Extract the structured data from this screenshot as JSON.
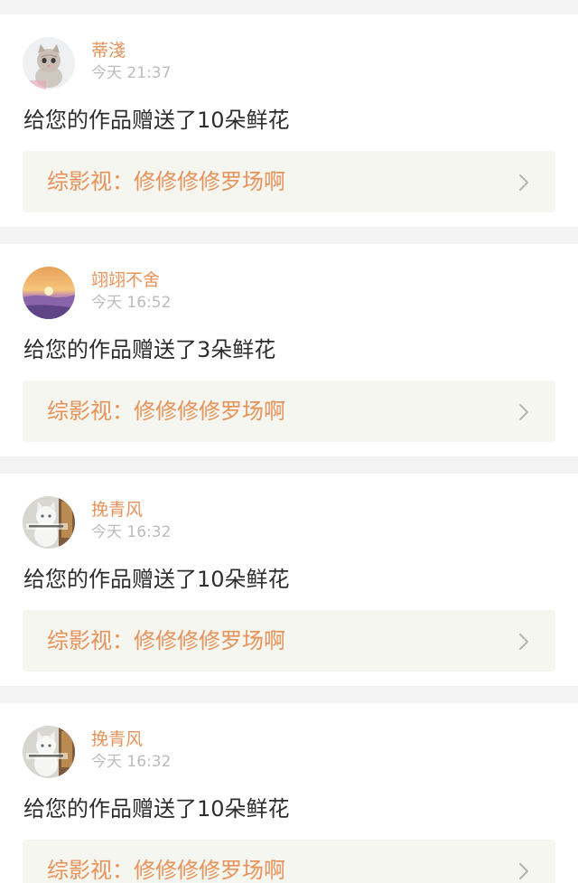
{
  "notifications": [
    {
      "username": "蒂淺",
      "time": "今天 21:37",
      "message": "给您的作品赠送了10朵鲜花",
      "work_title": "综影视：修修修修罗场啊",
      "avatar_icon": "kitten-avatar"
    },
    {
      "username": "翊翊不舍",
      "time": "今天 16:52",
      "message": "给您的作品赠送了3朵鲜花",
      "work_title": "综影视：修修修修罗场啊",
      "avatar_icon": "sunset-lavender-avatar"
    },
    {
      "username": "挽青风",
      "time": "今天 16:32",
      "message": "给您的作品赠送了10朵鲜花",
      "work_title": "综影视：修修修修罗场啊",
      "avatar_icon": "white-cat-avatar"
    },
    {
      "username": "挽青风",
      "time": "今天 16:32",
      "message": "给您的作品赠送了10朵鲜花",
      "work_title": "综影视：修修修修罗场啊",
      "avatar_icon": "white-cat-avatar"
    }
  ],
  "colors": {
    "accent": "#e8925a",
    "muted": "#bcbcbc",
    "text": "#2d2d2d",
    "link_background": "#f5f6ef",
    "page_background": "#f3f3f3"
  }
}
